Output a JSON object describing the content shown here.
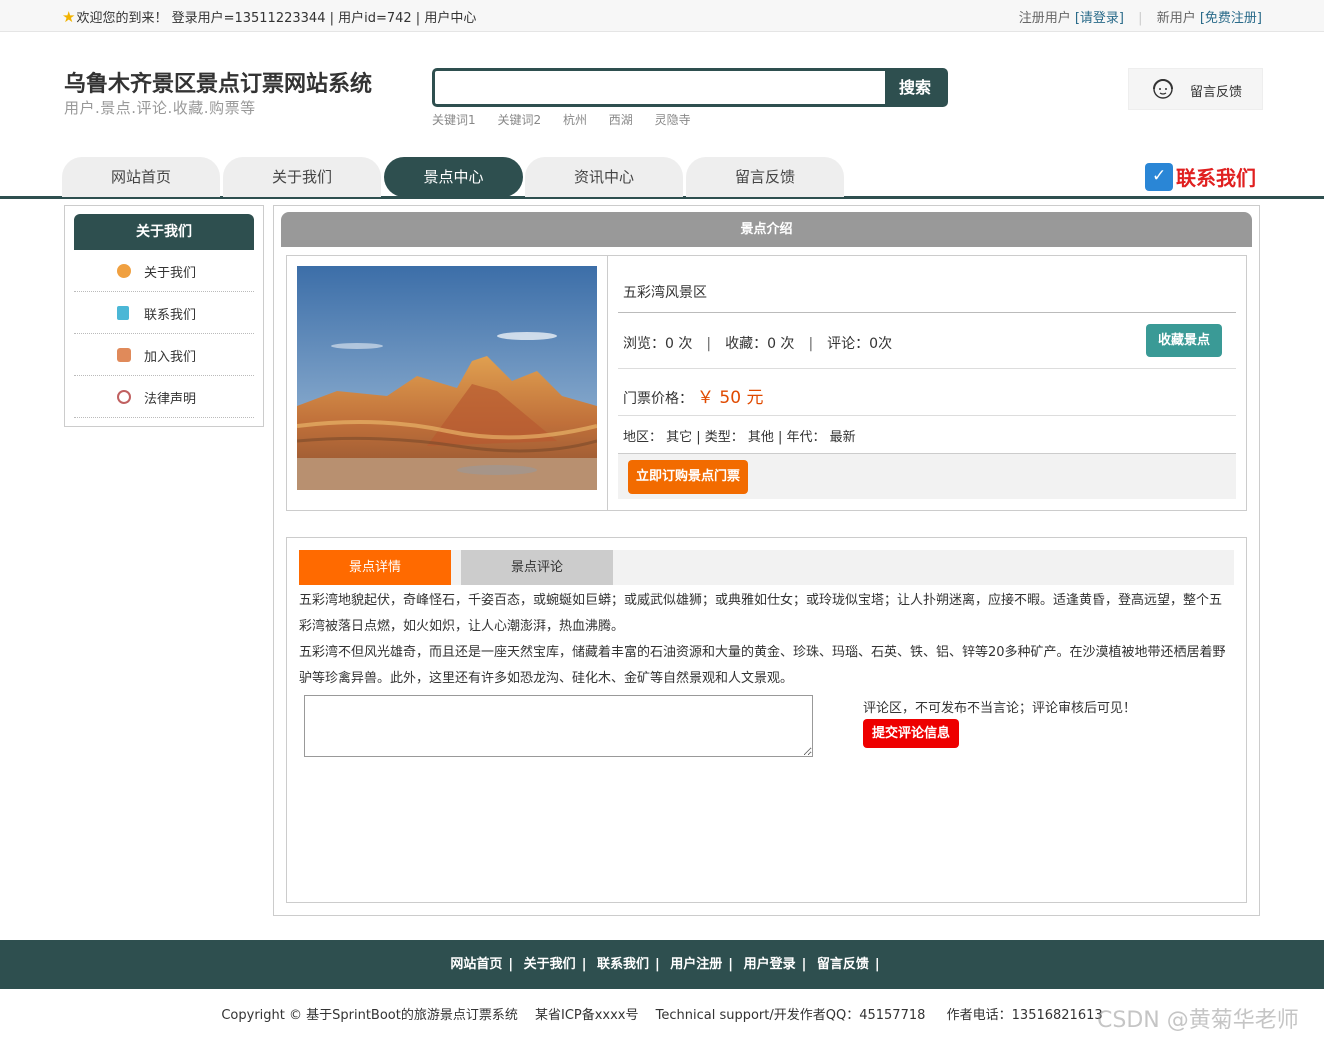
{
  "topbar": {
    "welcome": "欢迎您的到来！ 登录用户=13511223344 | 用户id=742 | 用户中心",
    "register_user": "注册用户",
    "login_link": "[请登录]",
    "new_user": "新用户",
    "free_register": "[免费注册]"
  },
  "header": {
    "title": "乌鲁木齐景区景点订票网站系统",
    "subtitle": "用户.景点.评论.收藏.购票等",
    "search_button": "搜索",
    "keywords": [
      "关键词1",
      "关键词2",
      "杭州",
      "西湖",
      "灵隐寺"
    ],
    "feedback": "留言反馈"
  },
  "nav": {
    "items": [
      "网站首页",
      "关于我们",
      "景点中心",
      "资讯中心",
      "留言反馈"
    ],
    "active_index": 2,
    "contact": "联系我们"
  },
  "sidebar": {
    "title": "关于我们",
    "items": [
      {
        "label": "关于我们",
        "icon": "about-icon",
        "color": "#f0a040"
      },
      {
        "label": "联系我们",
        "icon": "clipboard-icon",
        "color": "#4bb7d6"
      },
      {
        "label": "加入我们",
        "icon": "lock-icon",
        "color": "#e08a5a"
      },
      {
        "label": "法律声明",
        "icon": "power-icon",
        "color": "#c06060"
      }
    ]
  },
  "spot": {
    "section_title": "景点介绍",
    "name": "五彩湾风景区",
    "views_label": "浏览：",
    "views": "0 次",
    "favs_label": "收藏：",
    "favs": "0 次",
    "comments_label": "评论：",
    "comments": "0次",
    "fav_button": "收藏景点",
    "price_label": "门票价格：",
    "price": "￥ 50 元",
    "meta": "地区： 其它 | 类型： 其他 | 年代： 最新",
    "buy_button": "立即订购景点门票"
  },
  "detail": {
    "tab_detail": "景点详情",
    "tab_comments": "景点评论",
    "paragraph1": "五彩湾地貌起伏，奇峰怪石，千姿百态，或蜿蜒如巨蟒；或威武似雄狮；或典雅如仕女；或玲珑似宝塔；让人扑朔迷离，应接不暇。适逢黄昏，登高远望，整个五彩湾被落日点燃，如火如炽，让人心潮澎湃，热血沸腾。",
    "paragraph2": "五彩湾不但风光雄奇，而且还是一座天然宝库，储藏着丰富的石油资源和大量的黄金、珍珠、玛瑙、石英、铁、铝、锌等20多种矿产。在沙漠植被地带还栖居着野驴等珍禽异兽。此外，这里还有许多如恐龙沟、硅化木、金矿等自然景观和人文景观。",
    "comment_note": "评论区，不可发布不当言论；评论审核后可见！",
    "submit_button": "提交评论信息"
  },
  "footer": {
    "links": [
      "网站首页",
      "关于我们",
      "联系我们",
      "用户注册",
      "用户登录",
      "留言反馈"
    ],
    "copyright": "Copyright © 基于SprintBoot的旅游景点订票系统 　某省ICP备xxxx号 　Technical support/开发作者QQ：45157718 　 作者电话：13516821613",
    "watermark": "CSDN @黄菊华老师"
  },
  "colors": {
    "primary": "#2e4f4f",
    "accent_orange": "#ff6a00",
    "fav_teal": "#3a9a96",
    "submit_red": "#ee0000",
    "contact_red": "#e02020"
  }
}
